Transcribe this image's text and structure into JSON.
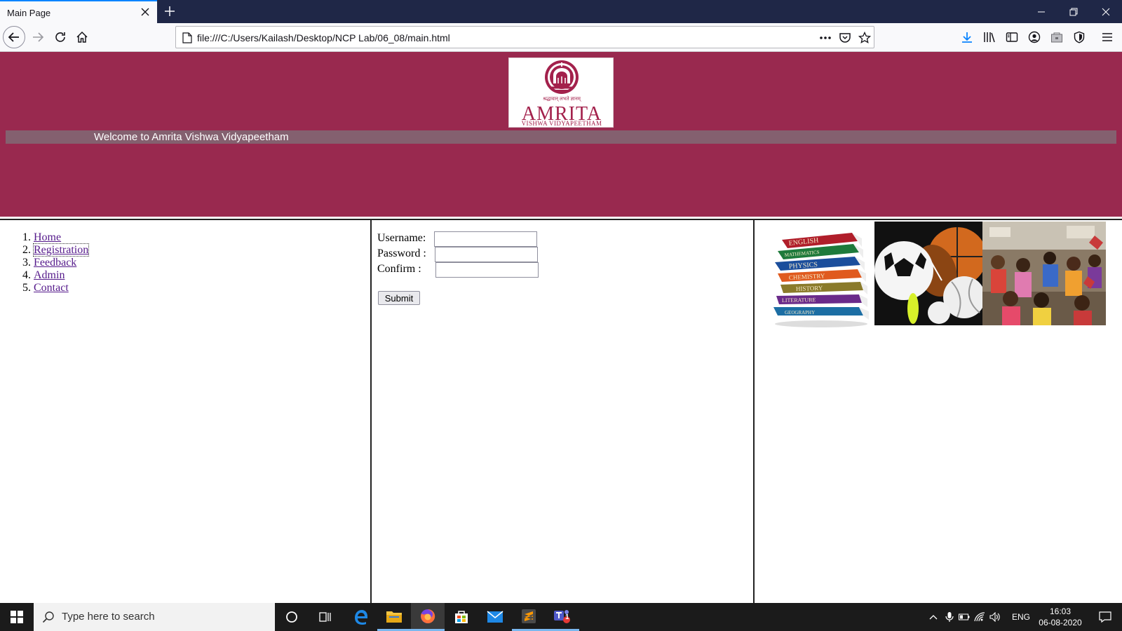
{
  "browser": {
    "tab_title": "Main Page",
    "url": "file:///C:/Users/Kailash/Desktop/NCP Lab/06_08/main.html"
  },
  "header": {
    "logo_name": "AMRITA",
    "logo_subtitle": "VISHWA VIDYAPEETHAM",
    "logo_motto": "श्रद्धावान् लभते ज्ञानम्",
    "welcome": "Welcome to Amrita Vishwa Vidyapeetham",
    "bg_color": "#99294f"
  },
  "nav": {
    "items": [
      {
        "num": "1.",
        "label": "Home"
      },
      {
        "num": "2.",
        "label": "Registration"
      },
      {
        "num": "3.",
        "label": "Feedback"
      },
      {
        "num": "4.",
        "label": "Admin"
      },
      {
        "num": "5.",
        "label": "Contact"
      }
    ]
  },
  "form": {
    "username_label": "Username:",
    "password_label": "Password :",
    "confirm_label": "Confirm :",
    "username_value": "",
    "password_value": "",
    "confirm_value": "",
    "submit_label": "Submit"
  },
  "images": {
    "book_titles": [
      "ENGLISH",
      "MATHEMATICS",
      "PHYSICS",
      "CHEMISTRY",
      "HISTORY",
      "LITERATURE",
      "GEOGRAPHY"
    ]
  },
  "taskbar": {
    "search_placeholder": "Type here to search",
    "language": "ENG",
    "time": "16:03",
    "date": "06-08-2020",
    "teams_badge": "1"
  }
}
